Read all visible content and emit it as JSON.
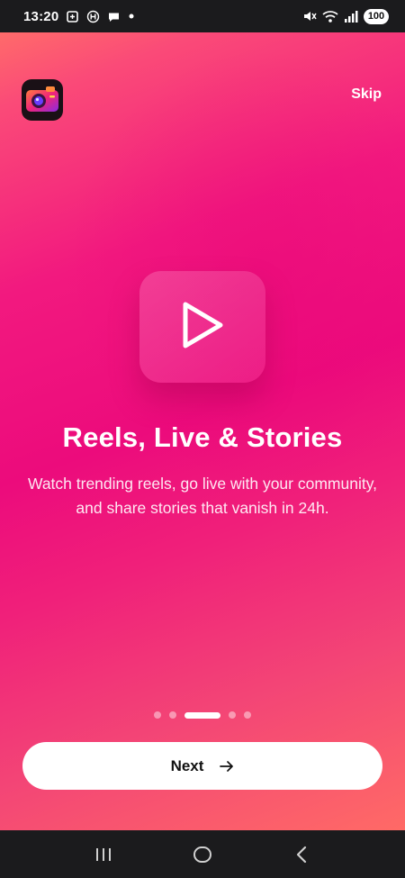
{
  "status_bar": {
    "time": "13:20",
    "battery": "100",
    "left_icons": [
      "screen-record-icon",
      "h-badge-icon",
      "chat-bubble-icon",
      "dot-icon"
    ],
    "right_icons": [
      "mute-icon",
      "wifi-icon",
      "signal-icon",
      "battery-icon"
    ]
  },
  "header": {
    "logo_icon": "camera-app-logo-icon",
    "skip_label": "Skip"
  },
  "slide": {
    "icon": "play-icon",
    "title": "Reels, Live & Stories",
    "description": "Watch trending reels, go live with your community, and share stories that vanish in 24h."
  },
  "pager": {
    "total": 5,
    "active_index": 2
  },
  "next_button": {
    "label": "Next",
    "icon": "arrow-right-icon"
  },
  "nav_bar": {
    "icons": [
      "recent-apps-icon",
      "home-icon",
      "back-icon"
    ]
  },
  "colors": {
    "gradient_start": "#ff6b6a",
    "gradient_mid": "#ec0b7c",
    "gradient_end": "#ff6a66",
    "bar_background": "#1b1b1d"
  }
}
